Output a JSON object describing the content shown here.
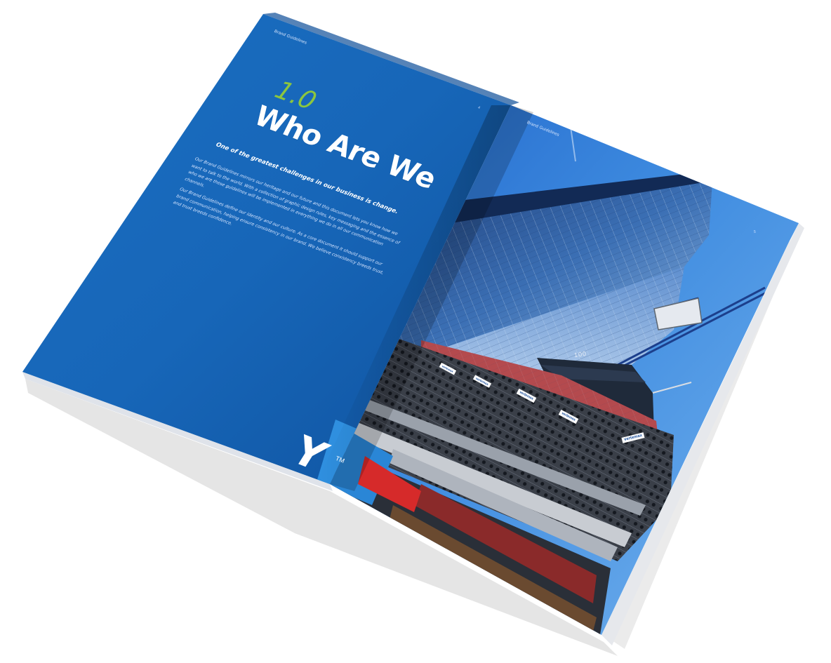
{
  "left_page": {
    "header": "Brand Guidelines",
    "section_number": "1.0",
    "title": "Who Are We",
    "lead": "One of the greatest challenges in our business is change.",
    "paragraphs": [
      "Our Brand Guidelines mirrors our heritage and our future and this document lets you know how we want to talk to the world. With a collection of graphic design rules, key messaging and the essence of who we are these guidelines will be implemented in everything we do in all our communication channels.",
      "Our Brand Guidelines define our identity and our culture.  As a core document it should support our brand communication, helping ensure consistency in our brand.  We believe consistency breeds trust, and trust breeds confidence."
    ],
    "page_number": "4",
    "bleed_text": "Y",
    "bleed_tm": "TM"
  },
  "right_page": {
    "header": "Brand Guidelines",
    "page_marker": "5",
    "building_number": "100",
    "sign_text": "vertemax"
  },
  "colors": {
    "page_blue": "#1463b3",
    "accent_green": "#8cc63f",
    "sky_blue": "#3d86d9"
  }
}
